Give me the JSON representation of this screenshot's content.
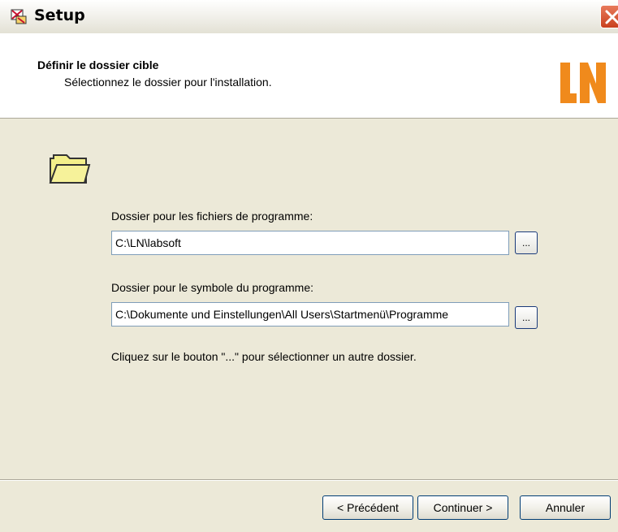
{
  "window": {
    "title": "Setup",
    "icon": "setup-app-icon"
  },
  "header": {
    "heading": "Définir le dossier cible",
    "subheading": "Sélectionnez le dossier pour l'installation.",
    "logo": "LN"
  },
  "program_files": {
    "label": "Dossier pour les fichiers de programme:",
    "value": "C:\\LN\\labsoft",
    "browse_label": "..."
  },
  "program_symbol": {
    "label": "Dossier pour le symbole du programme:",
    "value": "C:\\Dokumente und Einstellungen\\All Users\\Startmenü\\Programme",
    "browse_label": "..."
  },
  "hint": "Cliquez sur le bouton \"...\" pour sélectionner un autre dossier.",
  "buttons": {
    "back": "< Précédent",
    "next": "Continuer >",
    "cancel": "Annuler"
  },
  "colors": {
    "accent_orange": "#f08a1c",
    "title_close": "#d9532f",
    "folder_yellow": "#f3ef8a"
  }
}
